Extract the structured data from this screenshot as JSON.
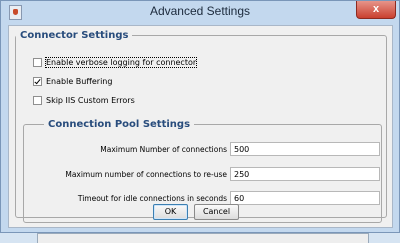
{
  "window": {
    "title": "Advanced Settings",
    "close_label": "x"
  },
  "connector_settings": {
    "legend": "Connector Settings",
    "options": [
      {
        "label": "Enable verbose logging for connector",
        "checked": false,
        "focused": true
      },
      {
        "label": "Enable Buffering",
        "checked": true,
        "focused": false
      },
      {
        "label": "Skip IIS Custom Errors",
        "checked": false,
        "focused": false
      }
    ]
  },
  "connection_pool": {
    "legend": "Connection Pool Settings",
    "fields": [
      {
        "label": "Maximum Number of connections",
        "value": "500"
      },
      {
        "label": "Maximum number of connections to re-use",
        "value": "250"
      },
      {
        "label": "Timeout for idle connections in seconds",
        "value": "60"
      }
    ]
  },
  "buttons": {
    "ok": "OK",
    "cancel": "Cancel"
  }
}
